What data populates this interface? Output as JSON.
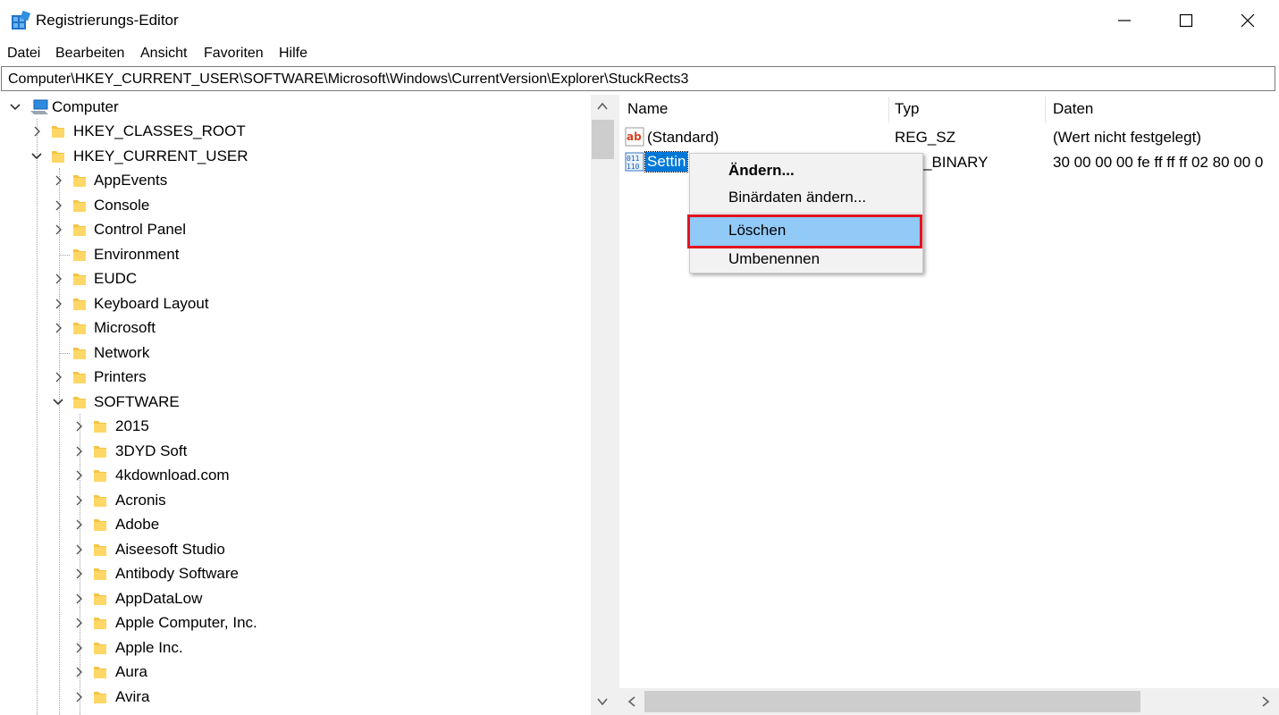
{
  "window": {
    "title": "Registrierungs-Editor",
    "controls": [
      "minimize",
      "maximize",
      "close"
    ]
  },
  "menu": [
    "Datei",
    "Bearbeiten",
    "Ansicht",
    "Favoriten",
    "Hilfe"
  ],
  "address": "Computer\\HKEY_CURRENT_USER\\SOFTWARE\\Microsoft\\Windows\\CurrentVersion\\Explorer\\StuckRects3",
  "tree": {
    "root": "Computer",
    "hives": [
      {
        "label": "HKEY_CLASSES_ROOT",
        "expanded": false
      },
      {
        "label": "HKEY_CURRENT_USER",
        "expanded": true
      }
    ],
    "hkcu_children": [
      {
        "label": "AppEvents",
        "has_children": true
      },
      {
        "label": "Console",
        "has_children": true
      },
      {
        "label": "Control Panel",
        "has_children": true
      },
      {
        "label": "Environment",
        "has_children": false
      },
      {
        "label": "EUDC",
        "has_children": true
      },
      {
        "label": "Keyboard Layout",
        "has_children": true
      },
      {
        "label": "Microsoft",
        "has_children": true
      },
      {
        "label": "Network",
        "has_children": false
      },
      {
        "label": "Printers",
        "has_children": true
      },
      {
        "label": "SOFTWARE",
        "has_children": true,
        "expanded": true
      }
    ],
    "software_children": [
      "2015",
      "3DYD Soft",
      "4kdownload.com",
      "Acronis",
      "Adobe",
      "Aiseesoft Studio",
      "Antibody Software",
      "AppDataLow",
      "Apple Computer, Inc.",
      "Apple Inc.",
      "Aura",
      "Avira"
    ]
  },
  "values_list": {
    "columns": {
      "name": "Name",
      "type": "Typ",
      "data": "Daten"
    },
    "rows": [
      {
        "icon": "string-value-icon",
        "name": "(Standard)",
        "type": "REG_SZ",
        "data": "(Wert nicht festgelegt)"
      },
      {
        "icon": "binary-value-icon",
        "name": "Settin",
        "type": "_BINARY",
        "data": "30 00 00 00 fe ff ff ff 02 80 00 0",
        "selected": true
      }
    ]
  },
  "context_menu": {
    "items": [
      {
        "label": "Ändern...",
        "bold": true
      },
      {
        "label": "Binärdaten ändern..."
      },
      {
        "label": "Löschen",
        "highlighted": true
      },
      {
        "label": "Umbenennen"
      }
    ]
  },
  "colors": {
    "selection": "#0078d7",
    "menu_hover": "#91c9f7",
    "annotation": "#e0141f",
    "folder": "#f5c443"
  }
}
